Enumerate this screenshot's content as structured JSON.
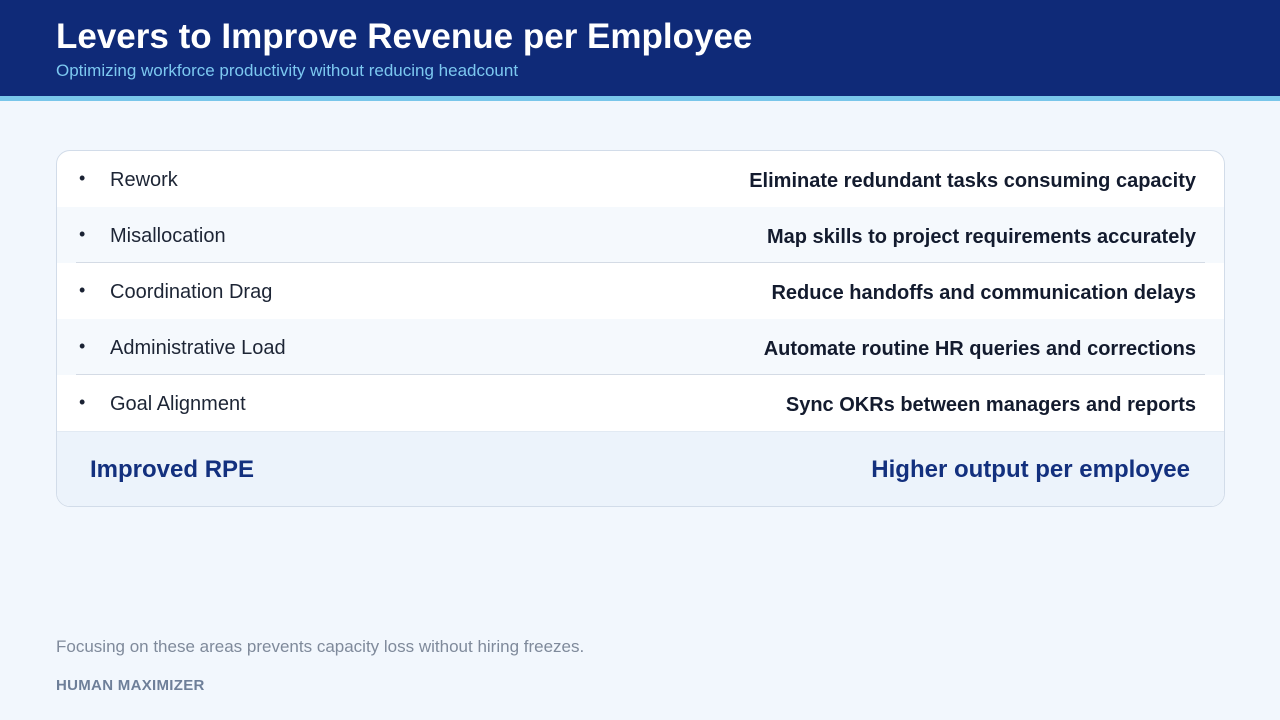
{
  "header": {
    "title": "Levers to Improve Revenue per Employee",
    "subtitle": "Optimizing workforce productivity without reducing headcount"
  },
  "levers": [
    {
      "bullet": "•",
      "label": "Rework",
      "action": "Eliminate redundant tasks consuming capacity"
    },
    {
      "bullet": "•",
      "label": "Misallocation",
      "action": "Map skills to project requirements accurately"
    },
    {
      "bullet": "•",
      "label": "Coordination Drag",
      "action": "Reduce handoffs and communication delays"
    },
    {
      "bullet": "•",
      "label": "Administrative Load",
      "action": "Automate routine HR queries and corrections"
    },
    {
      "bullet": "•",
      "label": "Goal Alignment",
      "action": "Sync OKRs between managers and reports"
    }
  ],
  "result": {
    "label": "Improved RPE",
    "outcome": "Higher output per employee"
  },
  "footer": {
    "note": "Focusing on these areas prevents capacity loss without hiring freezes.",
    "brand": "HUMAN MAXIMIZER"
  },
  "colors": {
    "header_bg": "#0f2a78",
    "accent": "#79c6ea",
    "page_bg": "#f2f7fd",
    "result_text": "#13307e"
  }
}
